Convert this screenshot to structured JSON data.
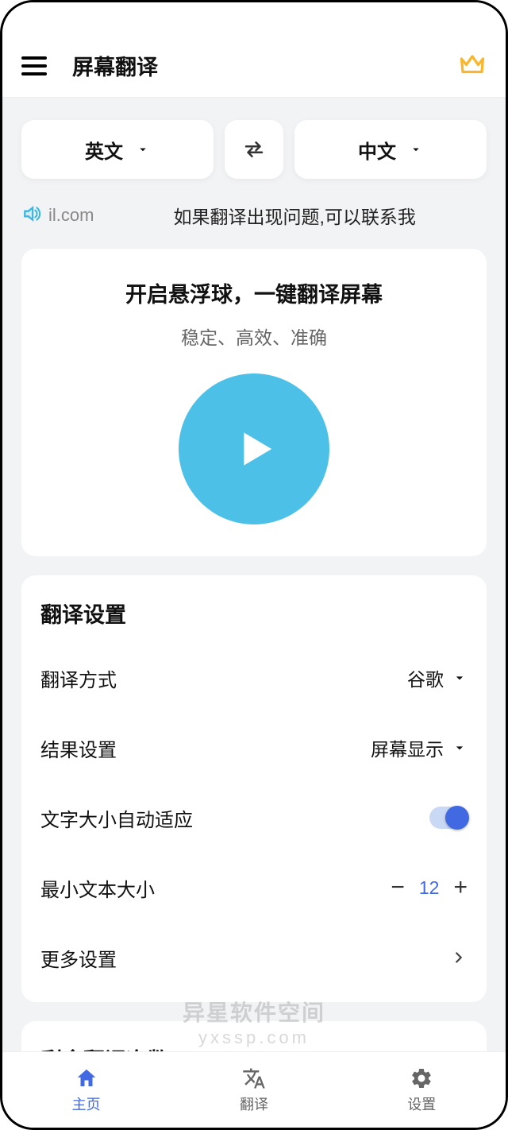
{
  "header": {
    "title": "屏幕翻译"
  },
  "lang": {
    "source": "英文",
    "target": "中文"
  },
  "ticker": {
    "left": "il.com",
    "right": "如果翻译出现问题,可以联系我"
  },
  "main": {
    "title": "开启悬浮球，一键翻译屏幕",
    "subtitle": "稳定、高效、准确"
  },
  "settings": {
    "title": "翻译设置",
    "method_label": "翻译方式",
    "method_value": "谷歌",
    "result_label": "结果设置",
    "result_value": "屏幕显示",
    "autosize_label": "文字大小自动适应",
    "minsize_label": "最小文本大小",
    "minsize_value": "12",
    "more_label": "更多设置"
  },
  "remaining": {
    "title": "剩余翻译次数"
  },
  "watermark": {
    "main": "异星软件空间",
    "sub": "yxssp.com"
  },
  "nav": {
    "home": "主页",
    "translate": "翻译",
    "settings": "设置"
  },
  "colors": {
    "accent": "#4169e1",
    "play": "#4dc0e8",
    "crown": "#f7b731"
  }
}
